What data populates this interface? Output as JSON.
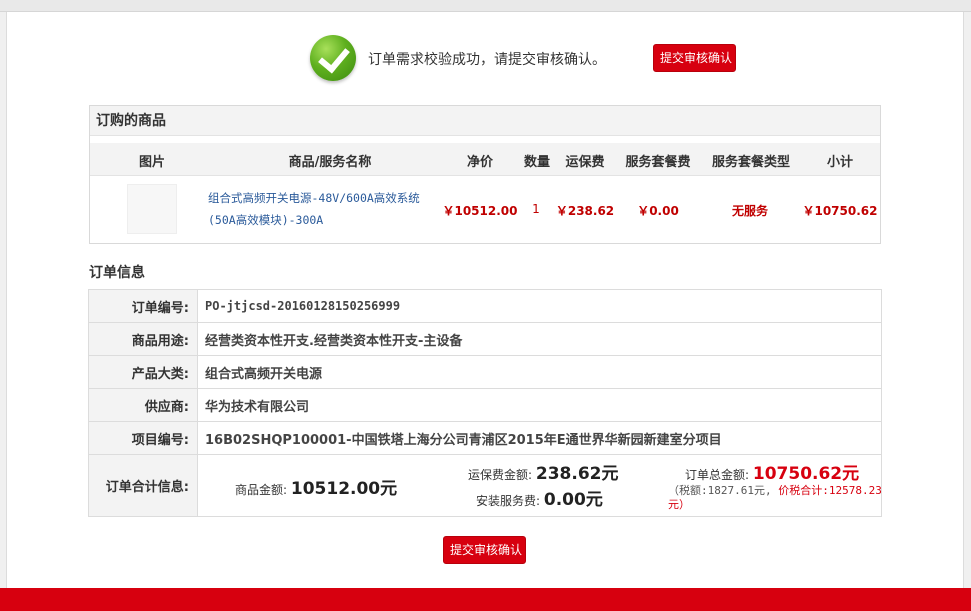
{
  "success": {
    "message": "订单需求校验成功，请提交审核确认。",
    "submit_label": "提交审核确认"
  },
  "goods": {
    "title": "订购的商品",
    "columns": [
      "图片",
      "商品/服务名称",
      "净价",
      "数量",
      "运保费",
      "服务套餐费",
      "服务套餐类型",
      "小计"
    ],
    "row": {
      "name": "组合式高频开关电源-48V/600A高效系统(50A高效模块)-300A",
      "net_price": "￥10512.00",
      "qty": "1",
      "shipping": "￥238.62",
      "service_fee": "￥0.00",
      "service_type": "无服务",
      "subtotal": "￥10750.62"
    }
  },
  "order_info": {
    "title": "订单信息",
    "rows": [
      {
        "label": "订单编号:",
        "value": "PO-jtjcsd-20160128150256999"
      },
      {
        "label": "商品用途:",
        "value": "经营类资本性开支.经营类资本性开支-主设备"
      },
      {
        "label": "产品大类:",
        "value": "组合式高频开关电源"
      },
      {
        "label": "供应商:",
        "value": "华为技术有限公司"
      },
      {
        "label": "项目编号:",
        "value": "16B02SHQP100001-中国铁塔上海分公司青浦区2015年E通世界华新园新建室分项目"
      }
    ],
    "summary": {
      "label": "订单合计信息:",
      "goods_amount_label": "商品金额:",
      "goods_amount": "10512.00元",
      "shipping_label": "运保费金额:",
      "shipping_amount": "238.62元",
      "install_label": "安装服务费:",
      "install_amount": "0.00元",
      "total_label": "订单总金额:",
      "total_amount": "10750.62元",
      "tax_text": "（税额:1827.61元,",
      "tax_total_label": "价税合计:",
      "tax_total_value": "12578.23",
      "tax_total_unit": "元）"
    }
  },
  "footer": {
    "submit_label": "提交审核确认"
  },
  "colors": {
    "accent": "#d7000f",
    "link": "#2a5a9a",
    "price": "#c00000"
  }
}
